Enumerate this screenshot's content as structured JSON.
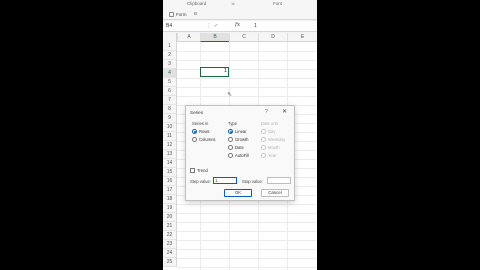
{
  "ribbon": {
    "clipboard_label": "Clipboard",
    "font_label": "Font",
    "format_label": "Form",
    "font_btn": "B"
  },
  "formula_bar": {
    "name_box": "B4",
    "fx": "fx",
    "value": "1"
  },
  "sheet": {
    "columns": [
      "A",
      "B",
      "C",
      "D",
      "E"
    ],
    "rows": [
      "1",
      "2",
      "3",
      "4",
      "5",
      "6",
      "7",
      "8",
      "9",
      "10",
      "11",
      "12",
      "13",
      "14",
      "15",
      "16",
      "17",
      "18",
      "19",
      "20",
      "21",
      "22",
      "23",
      "24",
      "25"
    ],
    "active_cell": "B4",
    "active_cell_value": "1"
  },
  "dialog": {
    "title": "Series",
    "help": "?",
    "close": "✕",
    "series_in_label": "Series in",
    "series_in_options": [
      "Rows",
      "Columns"
    ],
    "series_in_selected": "Rows",
    "type_label": "Type",
    "type_options": [
      "Linear",
      "Growth",
      "Date",
      "AutoFill"
    ],
    "type_selected": "Linear",
    "date_unit_label": "Date unit",
    "date_unit_options": [
      "Day",
      "Weekday",
      "Month",
      "Year"
    ],
    "trend_label": "Trend",
    "step_value_label": "Step value:",
    "step_value": "1",
    "stop_value_label": "Stop value:",
    "stop_value": "",
    "ok_label": "OK",
    "cancel_label": "Cancel"
  }
}
